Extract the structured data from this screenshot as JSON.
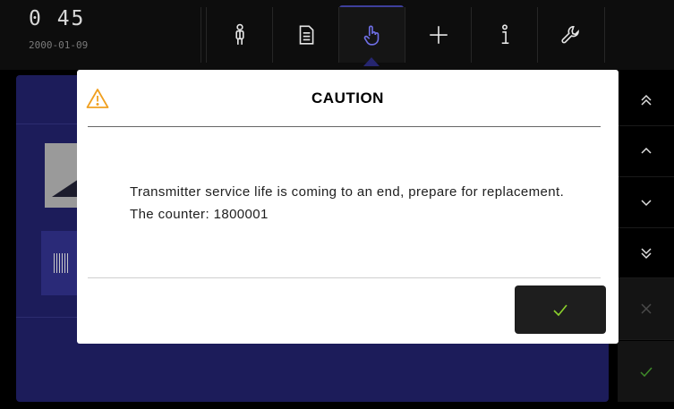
{
  "clock": {
    "time": "0 45",
    "date": "2000-01-09"
  },
  "nav_tabs": [
    {
      "icon": "person-icon"
    },
    {
      "icon": "document-icon"
    },
    {
      "icon": "hand-pointer-icon",
      "active": true
    },
    {
      "icon": "plus-icon"
    },
    {
      "icon": "info-icon"
    },
    {
      "icon": "wrench-icon"
    }
  ],
  "side_rail": [
    {
      "icon": "double-chevron-up-icon"
    },
    {
      "icon": "chevron-up-icon"
    },
    {
      "icon": "chevron-down-icon"
    },
    {
      "icon": "double-chevron-down-icon"
    },
    {
      "icon": "close-icon"
    },
    {
      "icon": "check-icon"
    }
  ],
  "dialog": {
    "icon": "warning-icon",
    "title": "CAUTION",
    "message": "Transmitter service life is coming to an end, prepare for replacement. The counter: 1800001",
    "confirm_icon": "check-icon"
  },
  "colors": {
    "accent_purple": "#3e3f9c",
    "warning_orange": "#f0a020",
    "confirm_green": "#8bd02c",
    "panel_navy": "#1c1c5a"
  }
}
